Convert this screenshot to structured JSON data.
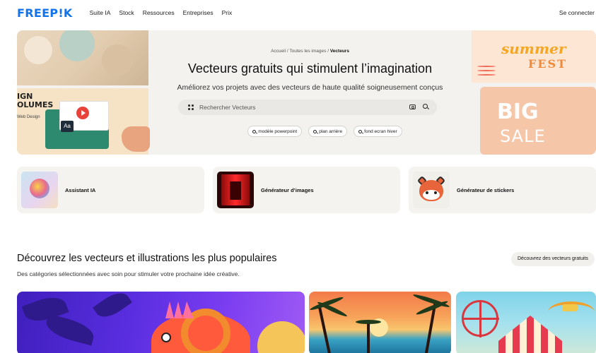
{
  "nav": {
    "logo": "FREEP!K",
    "links": [
      "Suite IA",
      "Stock",
      "Ressources",
      "Entreprises",
      "Prix"
    ],
    "signin": "Se connecter"
  },
  "hero": {
    "breadcrumb": [
      "Accueil",
      "Toutes les images",
      "Vecteurs"
    ],
    "breadcrumb_sep": "/",
    "title": "Vecteurs gratuits qui stimulent l’imagination",
    "subtitle": "Améliorez vos projets avec des vecteurs de haute qualité soigneusement conçus",
    "search_placeholder": "Rechercher Vecteurs",
    "chips": [
      "modèle powerpoint",
      "plan arrière",
      "fond ecran hiver"
    ],
    "left_art": {
      "heading_line1": "IGN",
      "heading_line2": "OLUMES",
      "sub": "Web Design",
      "badge": "Aa"
    },
    "right_art": {
      "summer": "summer",
      "fest": "FEST",
      "big": "BIG",
      "sale": "SALE"
    }
  },
  "tools": [
    {
      "label": "Assistant IA",
      "icon": "ai-assistant-thumbnail"
    },
    {
      "label": "Générateur d’images",
      "icon": "image-generator-thumbnail"
    },
    {
      "label": "Générateur de stickers",
      "icon": "red-panda-sticker-thumbnail"
    }
  ],
  "section": {
    "title": "Découvrez les vecteurs et illustrations les plus populaires",
    "subtitle": "Des catégories sélectionnées avec soin pour stimuler votre prochaine idée créative.",
    "button": "Découvrez des vecteurs gratuits"
  },
  "colors": {
    "brand": "#1273eb",
    "hero_bg": "#f3f2ee",
    "card_bg": "#f4f3f0"
  }
}
